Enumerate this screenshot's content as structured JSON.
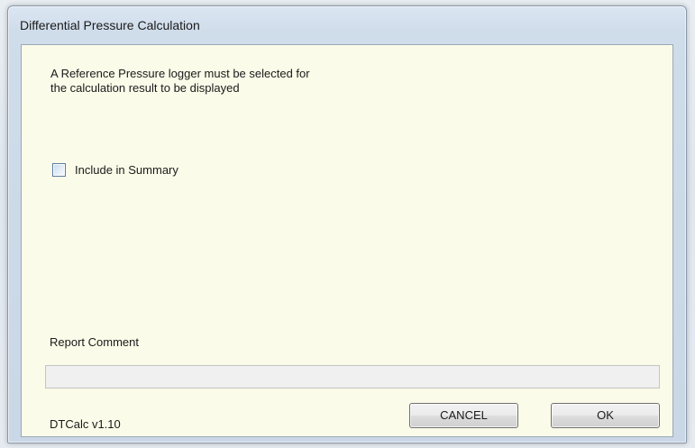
{
  "window": {
    "title": "Differential Pressure Calculation"
  },
  "message": {
    "line1": "A Reference Pressure logger must be selected for",
    "line2": "the calculation result to be displayed"
  },
  "summary_checkbox": {
    "label": "Include in Summary",
    "checked": false
  },
  "report_comment": {
    "label": "Report Comment",
    "value": ""
  },
  "footer": {
    "version": "DTCalc v1.10",
    "cancel_label": "CANCEL",
    "ok_label": "OK"
  },
  "colors": {
    "client_background": "#fbfbe9",
    "input_background": "#f0f0f0"
  }
}
